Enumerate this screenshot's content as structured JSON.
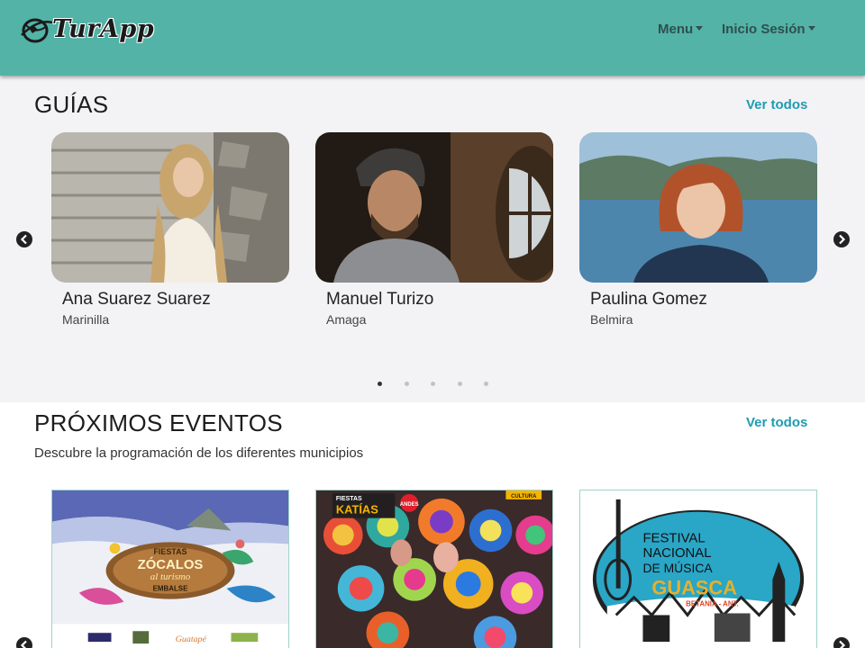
{
  "navbar": {
    "logo_text": "TurApp",
    "menu_label": "Menu",
    "login_label": "Inicio Sesión"
  },
  "guides": {
    "title": "GUÍAS",
    "see_all": "Ver todos",
    "items": [
      {
        "name": "Ana Suarez Suarez",
        "town": "Marinilla"
      },
      {
        "name": "Manuel Turizo",
        "town": "Amaga"
      },
      {
        "name": "Paulina Gomez",
        "town": "Belmira"
      }
    ],
    "pager": {
      "pages": 5,
      "active": 1
    }
  },
  "events": {
    "title": "PRÓXIMOS EVENTOS",
    "see_all": "Ver todos",
    "subtitle": "Descubre la programación de los diferentes municipios",
    "items": [
      {
        "poster_lines": [
          "FIESTAS",
          "ZÓCALOS",
          "al turismo",
          "EMBALSE",
          "Guatapé"
        ]
      },
      {
        "poster_lines": [
          "FIESTAS",
          "KATÍAS",
          "ANDES",
          "CULTURA"
        ]
      },
      {
        "poster_lines": [
          "FESTIVAL",
          "NACIONAL",
          "DE MÚSICA",
          "GUASCA",
          "BETANIA - ANT."
        ]
      }
    ]
  },
  "colors": {
    "navbar": "#52b3a6",
    "link": "#1f9bb0",
    "guides_bg": "#f3f3f5",
    "events_bg": "#ffffff"
  },
  "icons": [
    "globe-logo-icon",
    "chevron-left-icon",
    "chevron-right-icon",
    "caret-down-icon"
  ]
}
